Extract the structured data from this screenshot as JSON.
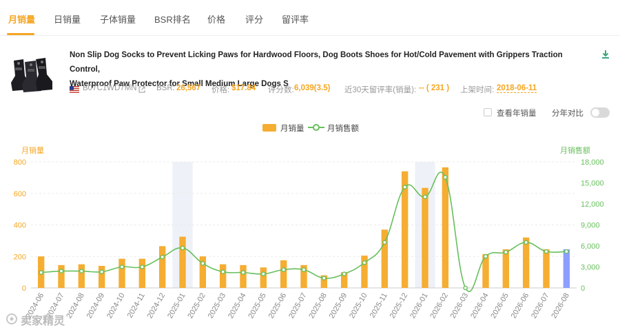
{
  "tabs": [
    {
      "label": "月销量",
      "active": true
    },
    {
      "label": "日销量",
      "active": false
    },
    {
      "label": "子体销量",
      "active": false
    },
    {
      "label": "BSR排名",
      "active": false
    },
    {
      "label": "价格",
      "active": false
    },
    {
      "label": "评分",
      "active": false
    },
    {
      "label": "留评率",
      "active": false
    }
  ],
  "product": {
    "title_line1": "Non Slip Dog Socks to Prevent Licking Paws for Hardwood Floors, Dog Boots Shoes for Hot/Cold Pavement with Grippers Traction Control,",
    "title_line2": "Waterproof Paw Protector for Small Medium Large Dogs S",
    "asin": "B07C1WD7MN",
    "bsr_label": "BSR:",
    "bsr_value": "26,567",
    "price_label": "价格:",
    "price_value": "$17.84",
    "ratings_label": "评分数:",
    "ratings_value": "6,039(3.5)",
    "review_rate_label": "近30天留评率(销量):",
    "review_rate_value": "-- ( 231 )",
    "launch_label": "上架时间:",
    "launch_value": "2018-06-11"
  },
  "controls": {
    "yearly_checkbox_label": "查看年销量",
    "yearly_compare_label": "分年对比"
  },
  "watermark": "卖家精灵",
  "colors": {
    "accent": "#f5a623",
    "bar": "#f5ad32",
    "bar_highlight": "#8c9eff",
    "line": "#67bf5c"
  },
  "chart_data": {
    "type": "bar",
    "legend": [
      "月销量",
      "月销售额"
    ],
    "left_axis_title": "月销量",
    "right_axis_title": "月销售额",
    "ylim_left": [
      0,
      800
    ],
    "yticks_left": [
      "0",
      "200",
      "400",
      "600",
      "800"
    ],
    "ylim_right": [
      0,
      18000
    ],
    "yticks_right": [
      "0",
      "3,000",
      "6,000",
      "9,000",
      "12,000",
      "15,000",
      "18,000"
    ],
    "categories": [
      "2024-06",
      "2024-07",
      "2024-08",
      "2024-09",
      "2024-10",
      "2024-11",
      "2024-12",
      "2025-01",
      "2025-02",
      "2025-03",
      "2025-04",
      "2025-05",
      "2025-06",
      "2025-07",
      "2025-08",
      "2025-09",
      "2025-10",
      "2025-11",
      "2025-12",
      "2026-01",
      "2026-02",
      "2026-03",
      "2026-04",
      "2026-05",
      "2026-06",
      "2026-07",
      "2026-08"
    ],
    "series": [
      {
        "name": "月销量",
        "type": "bar",
        "values": [
          200,
          145,
          150,
          140,
          185,
          185,
          265,
          325,
          200,
          150,
          145,
          130,
          175,
          145,
          80,
          100,
          205,
          370,
          740,
          635,
          765,
          0,
          215,
          245,
          320,
          245,
          245
        ]
      },
      {
        "name": "月销售额",
        "type": "line",
        "values": [
          2200,
          2400,
          2400,
          2300,
          3000,
          3000,
          4400,
          5700,
          3500,
          2300,
          2200,
          2000,
          2600,
          2600,
          1400,
          2000,
          3600,
          6500,
          14400,
          13000,
          15800,
          0,
          4500,
          5100,
          6500,
          5200,
          5200
        ]
      }
    ],
    "highlighted_bar": "2026-08",
    "shaded_columns": [
      "2025-01",
      "2026-01"
    ],
    "grid": true
  }
}
